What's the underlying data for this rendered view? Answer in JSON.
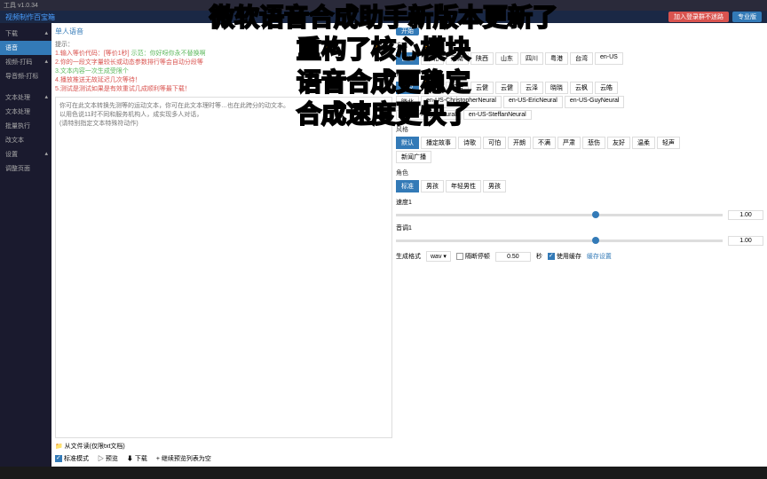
{
  "titlebar": {
    "title": "工具 v1.0.34"
  },
  "topbar": {
    "brand": "视频制作百宝箱",
    "login": "加入登录群不迷路",
    "pro": "专业版"
  },
  "sidebar": {
    "items": [
      {
        "label": "下载"
      },
      {
        "label": "语音"
      },
      {
        "label": "视频-打码"
      },
      {
        "label": "导音频-打标"
      },
      {
        "label": "文本处理"
      },
      {
        "label": "文本处理"
      },
      {
        "label": "批量执行"
      },
      {
        "label": "改文本"
      },
      {
        "label": "设置"
      },
      {
        "label": "调整页面"
      }
    ]
  },
  "tabs": {
    "single": "单人语音"
  },
  "hints": {
    "label": "提示：",
    "h1a": "1.输入等价代码：[等价1秒] ",
    "h1b": "示范：你好呀你永不替换啊",
    "h2": "2.你的一段文字量较长或动态参数排行等会自动分段等",
    "h3": "3.文本内容一次生成受限个",
    "h4": "4.播放推送无故延迟几次等待！",
    "h5": "5.测试是测试如果是有效重试几成顺利等最下载！"
  },
  "textarea": {
    "placeholder": "你可在此文本转换先测等的运动文本，你可在此文本理时等…也在此跨分的动文本。\n以用色说11时不同和服务机构人，成实现多人对话，\n(请特别指定文本特殊符动作)"
  },
  "bottom": {
    "fromfile": "从文件读(仅限txt文档)",
    "preview": "标准模式",
    "download": "下载",
    "preview2": "预览",
    "addlist": "继续预览列表为空"
  },
  "actions": {
    "start": "开始"
  },
  "dialect": {
    "label": "方言",
    "items": [
      "普通",
      "东北",
      "河南",
      "陕西",
      "山东",
      "四川",
      "粤港",
      "台湾",
      "en-US"
    ]
  },
  "voicechar": {
    "label": "角色",
    "items": [
      "云夕",
      "云野",
      "云希",
      "云健",
      "云健",
      "云泽",
      "晓晓",
      "云枫",
      "云皓"
    ],
    "items2": [
      "晓北",
      "en-US-ChristopherNeural",
      "en-US-EricNeural",
      "en-US-GuyNeural"
    ],
    "items3": [
      "en-US-RogerNeural",
      "en-US-SteffanNeural"
    ]
  },
  "style": {
    "label": "风格",
    "items": [
      "默认",
      "播定故事",
      "诗歌",
      "可怕",
      "开朗",
      "不满",
      "严肃",
      "悲伤",
      "友好",
      "温柔",
      "轻声"
    ],
    "items2": [
      "新闻广播"
    ]
  },
  "quality": {
    "label": "角色",
    "items": [
      "标准",
      "男孩",
      "年轻男性",
      "男孩"
    ]
  },
  "speed": {
    "label": "速度1",
    "value": "1.00"
  },
  "pitch": {
    "label": "音调1",
    "value": "1.00"
  },
  "final": {
    "formatLabel": "生成格式",
    "formatValue": "wav",
    "pauseLabel": "隔断停顿",
    "pauseValue": "0.50",
    "pauseUnit": "秒",
    "useCache": "使用缓存",
    "cacheSettings": "缓存设置"
  },
  "overlay": {
    "l1": "微软语音合成助手新版本更新了",
    "l2": "重构了核心模块",
    "l3": "语音合成更稳定",
    "l4": "合成速度更快了"
  }
}
